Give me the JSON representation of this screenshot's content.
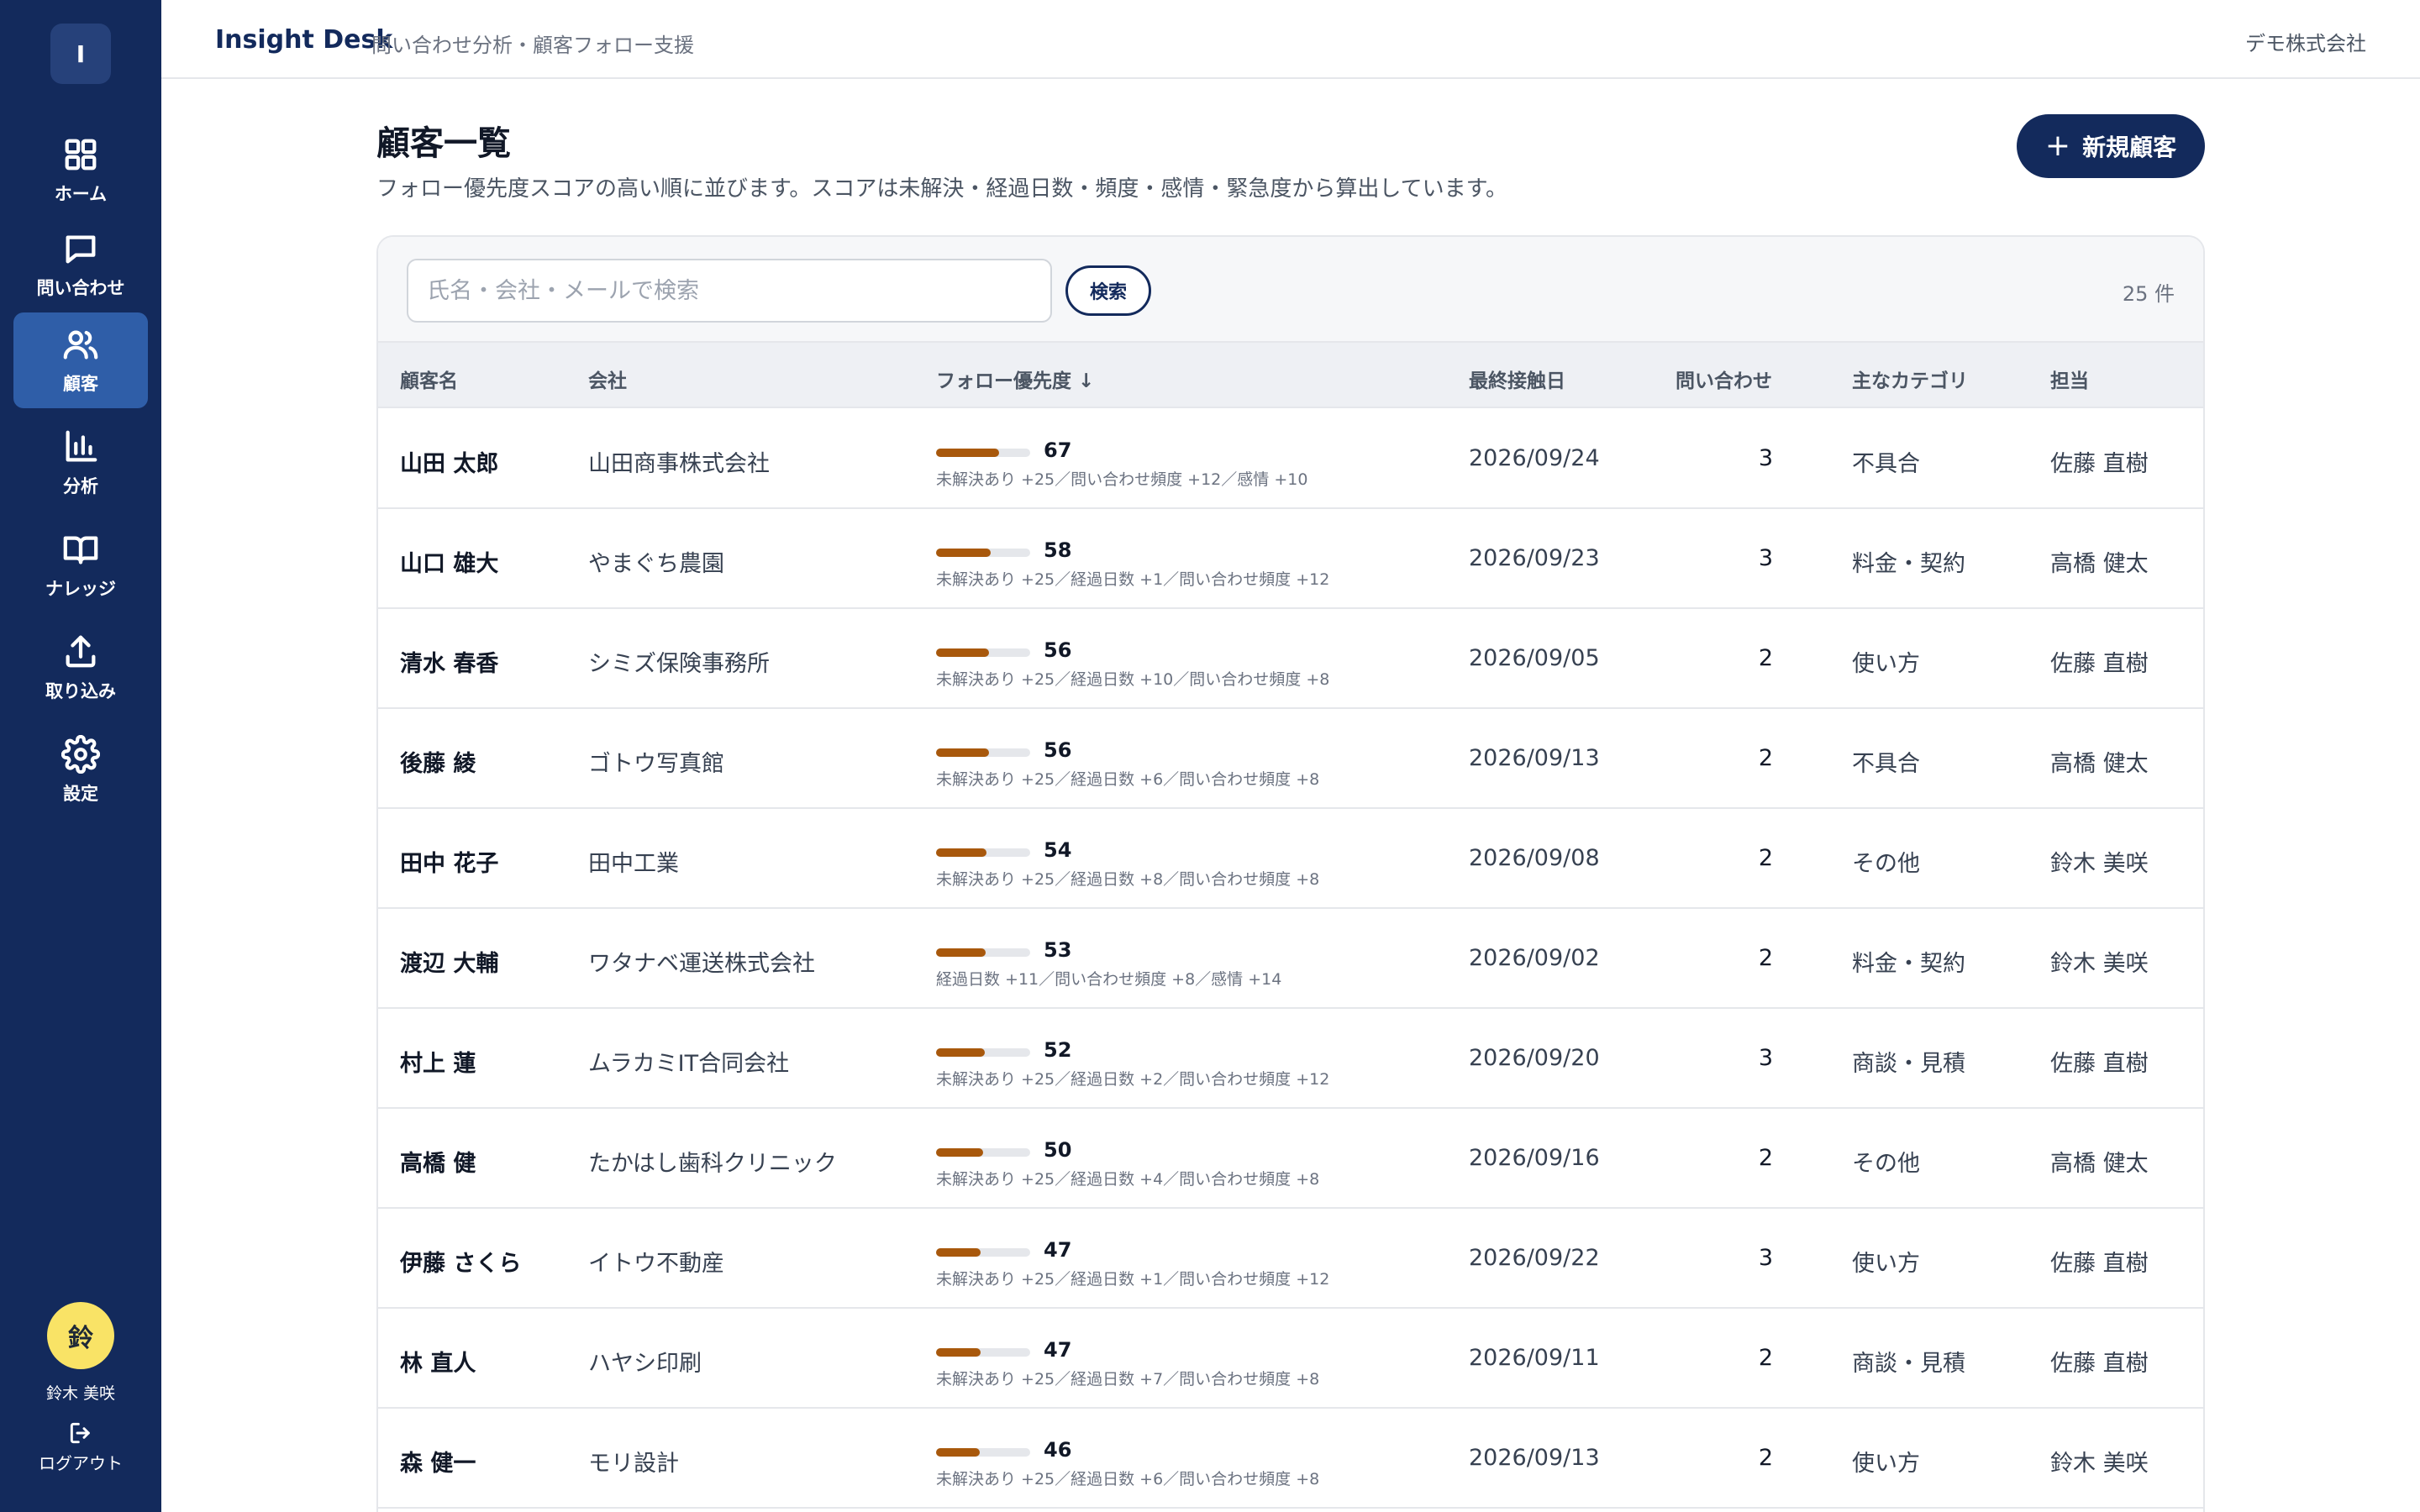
{
  "sidebar": {
    "logo_letter": "I",
    "items": [
      {
        "label": "ホーム",
        "icon": "grid-icon"
      },
      {
        "label": "問い合わせ",
        "icon": "chat-icon"
      },
      {
        "label": "顧客",
        "icon": "users-icon",
        "active": true
      },
      {
        "label": "分析",
        "icon": "bar-chart-icon"
      },
      {
        "label": "ナレッジ",
        "icon": "book-icon"
      },
      {
        "label": "取り込み",
        "icon": "upload-icon"
      },
      {
        "label": "設定",
        "icon": "gear-icon"
      }
    ],
    "user": {
      "avatar_char": "鈴",
      "name": "鈴木 美咲"
    },
    "logout_label": "ログアウト"
  },
  "header": {
    "title": "Insight Desk",
    "subtitle": "問い合わせ分析・顧客フォロー支援",
    "org": "デモ株式会社"
  },
  "page": {
    "title": "顧客一覧",
    "description": "フォロー優先度スコアの高い順に並びます。スコアは未解決・経過日数・頻度・感情・緊急度から算出しています。",
    "new_button_label": "新規顧客"
  },
  "search": {
    "placeholder": "氏名・会社・メールで検索",
    "button_label": "検索",
    "result_count": "25 件"
  },
  "table": {
    "columns": {
      "name": "顧客名",
      "company": "会社",
      "priority": "フォロー優先度 ↓",
      "last_contact": "最終接触日",
      "inquiries": "問い合わせ",
      "category": "主なカテゴリ",
      "owner": "担当"
    },
    "rows": [
      {
        "name": "山田 太郎",
        "company": "山田商事株式会社",
        "score": "67",
        "score_value": 67,
        "reason": "未解決あり +25／問い合わせ頻度 +12／感情 +10",
        "last_contact": "2026/09/24",
        "inquiries": "3",
        "category": "不具合",
        "owner": "佐藤 直樹"
      },
      {
        "name": "山口 雄大",
        "company": "やまぐち農園",
        "score": "58",
        "score_value": 58,
        "reason": "未解決あり +25／経過日数 +1／問い合わせ頻度 +12",
        "last_contact": "2026/09/23",
        "inquiries": "3",
        "category": "料金・契約",
        "owner": "高橋 健太"
      },
      {
        "name": "清水 春香",
        "company": "シミズ保険事務所",
        "score": "56",
        "score_value": 56,
        "reason": "未解決あり +25／経過日数 +10／問い合わせ頻度 +8",
        "last_contact": "2026/09/05",
        "inquiries": "2",
        "category": "使い方",
        "owner": "佐藤 直樹"
      },
      {
        "name": "後藤 綾",
        "company": "ゴトウ写真館",
        "score": "56",
        "score_value": 56,
        "reason": "未解決あり +25／経過日数 +6／問い合わせ頻度 +8",
        "last_contact": "2026/09/13",
        "inquiries": "2",
        "category": "不具合",
        "owner": "高橋 健太"
      },
      {
        "name": "田中 花子",
        "company": "田中工業",
        "score": "54",
        "score_value": 54,
        "reason": "未解決あり +25／経過日数 +8／問い合わせ頻度 +8",
        "last_contact": "2026/09/08",
        "inquiries": "2",
        "category": "その他",
        "owner": "鈴木 美咲"
      },
      {
        "name": "渡辺 大輔",
        "company": "ワタナベ運送株式会社",
        "score": "53",
        "score_value": 53,
        "reason": "経過日数 +11／問い合わせ頻度 +8／感情 +14",
        "last_contact": "2026/09/02",
        "inquiries": "2",
        "category": "料金・契約",
        "owner": "鈴木 美咲"
      },
      {
        "name": "村上 蓮",
        "company": "ムラカミIT合同会社",
        "score": "52",
        "score_value": 52,
        "reason": "未解決あり +25／経過日数 +2／問い合わせ頻度 +12",
        "last_contact": "2026/09/20",
        "inquiries": "3",
        "category": "商談・見積",
        "owner": "佐藤 直樹"
      },
      {
        "name": "高橋 健",
        "company": "たかはし歯科クリニック",
        "score": "50",
        "score_value": 50,
        "reason": "未解決あり +25／経過日数 +4／問い合わせ頻度 +8",
        "last_contact": "2026/09/16",
        "inquiries": "2",
        "category": "その他",
        "owner": "高橋 健太"
      },
      {
        "name": "伊藤 さくら",
        "company": "イトウ不動産",
        "score": "47",
        "score_value": 47,
        "reason": "未解決あり +25／経過日数 +1／問い合わせ頻度 +12",
        "last_contact": "2026/09/22",
        "inquiries": "3",
        "category": "使い方",
        "owner": "佐藤 直樹"
      },
      {
        "name": "林 直人",
        "company": "ハヤシ印刷",
        "score": "47",
        "score_value": 47,
        "reason": "未解決あり +25／経過日数 +7／問い合わせ頻度 +8",
        "last_contact": "2026/09/11",
        "inquiries": "2",
        "category": "商談・見積",
        "owner": "佐藤 直樹"
      },
      {
        "name": "森 健一",
        "company": "モリ設計",
        "score": "46",
        "score_value": 46,
        "reason": "未解決あり +25／経過日数 +6／問い合わせ頻度 +8",
        "last_contact": "2026/09/13",
        "inquiries": "2",
        "category": "使い方",
        "owner": "鈴木 美咲"
      }
    ]
  },
  "colors": {
    "sidebar_bg": "#132a5c",
    "sidebar_active": "#2f5ea8",
    "primary": "#132a5c",
    "score_bar": "#a8580c",
    "avatar_bg": "#f9e366"
  }
}
